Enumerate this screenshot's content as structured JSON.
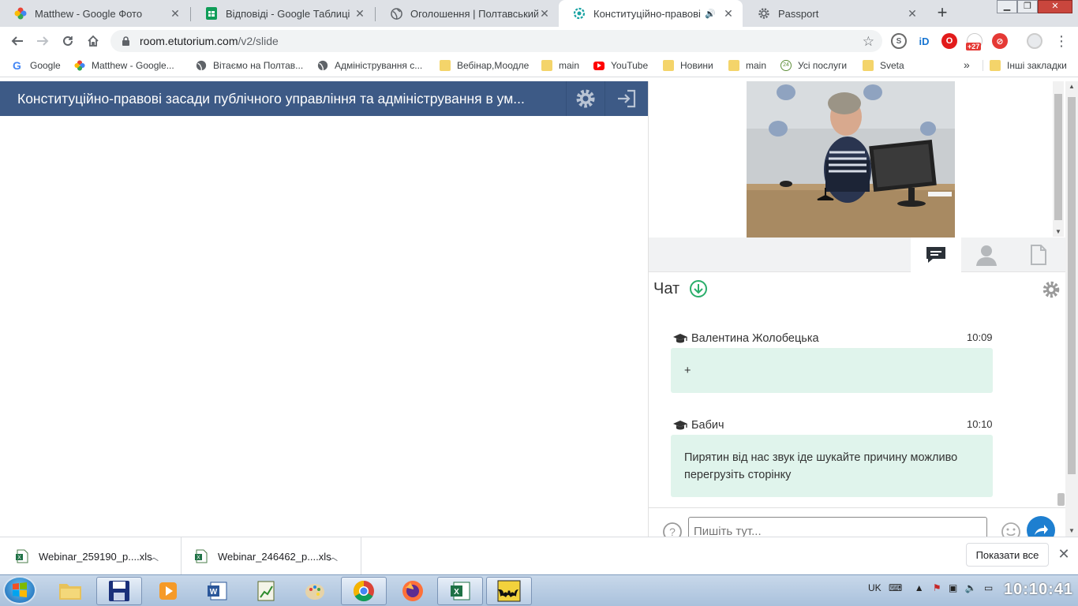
{
  "tabs": [
    {
      "label": "Matthew - Google Фото",
      "icon": "google-photos-icon"
    },
    {
      "label": "Відповіді - Google Таблиці",
      "icon": "google-sheets-icon"
    },
    {
      "label": "Оголошення | Полтавський обл",
      "icon": "globe-icon"
    },
    {
      "label": "Конституційно-правові зас",
      "icon": "etutorium-icon",
      "active": true,
      "audio": "🔊"
    },
    {
      "label": "Passport",
      "icon": "gear-icon"
    }
  ],
  "window_controls": {
    "minimize": "▁",
    "maximize": "❐",
    "close": "✕"
  },
  "toolbar": {
    "url_host": "room.etutorium.com",
    "url_path": "/v2/slide"
  },
  "extensions": {
    "badge": "+27"
  },
  "bookmarks": [
    {
      "label": "Google",
      "icon": "google-icon"
    },
    {
      "label": "Matthew - Google...",
      "icon": "google-photos-icon"
    },
    {
      "label": "Вітаємо на Полтав...",
      "icon": "globe-icon"
    },
    {
      "label": "Адміністрування с...",
      "icon": "globe-icon"
    },
    {
      "label": "Вебінар,Моодле",
      "icon": "folder-icon"
    },
    {
      "label": "main",
      "icon": "folder-icon"
    },
    {
      "label": "YouTube",
      "icon": "youtube-icon"
    },
    {
      "label": "Новини",
      "icon": "folder-icon"
    },
    {
      "label": "main",
      "icon": "folder-icon"
    },
    {
      "label": "Усі послуги",
      "icon": "24-icon"
    },
    {
      "label": "Sveta",
      "icon": "folder-icon"
    }
  ],
  "bookmarks_more": "»",
  "bookmarks_other": "Інші закладки",
  "header": {
    "title": "Конституційно-правові засади публічного управління та адміністрування в ум..."
  },
  "chat": {
    "title": "Чат",
    "messages": [
      {
        "author": "Валентина Жолобецька",
        "time": "10:09",
        "text": "+"
      },
      {
        "author": "Бабич",
        "time": "10:10",
        "text": "Пирятин від нас звук іде шукайте причину можливо перегрузіть сторінку"
      }
    ],
    "input_placeholder": "Пишіть тут..."
  },
  "downloads": {
    "items": [
      {
        "name": "Webinar_259190_p....xls"
      },
      {
        "name": "Webinar_246462_p....xls"
      }
    ],
    "show_all": "Показати все"
  },
  "taskbar": {
    "lang": "UK",
    "clock": "10:10:41"
  },
  "colors": {
    "header": "#3d5a86",
    "chat_bubble": "#e0f4ec",
    "send_button": "#1e7fd0",
    "accent_green": "#2aae6b"
  }
}
